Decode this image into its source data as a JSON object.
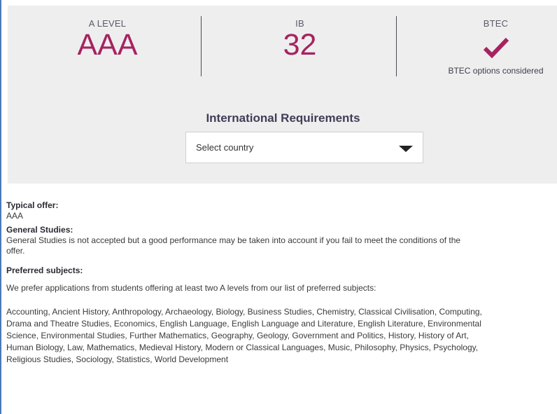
{
  "entry_requirements": {
    "a_level": {
      "label": "A LEVEL",
      "value": "AAA"
    },
    "ib": {
      "label": "IB",
      "value": "32"
    },
    "btec": {
      "label": "BTEC",
      "icon": "checkmark-icon",
      "note": "BTEC options considered"
    }
  },
  "international": {
    "title": "International Requirements",
    "select_placeholder": "Select country"
  },
  "details": {
    "typical_offer_heading": "Typical offer:",
    "typical_offer_value": "AAA",
    "general_studies_heading": "General Studies:",
    "general_studies_text": "General Studies is not accepted but a good performance may be taken into account if you fail to meet the conditions of the offer.",
    "preferred_heading": "Preferred subjects:",
    "preferred_intro": "We prefer applications from students offering at least two A levels from our list of preferred subjects:",
    "preferred_list": "Accounting, Ancient History, Anthropology, Archaeology, Biology, Business Studies, Chemistry, Classical Civilisation, Computing, Drama and Theatre Studies, Economics, English Language, English Language and Literature, English Literature, Environmental Science, Environmental Studies, Further Mathematics, Geography, Geology, Government and Politics, History, History of Art, Human Biology, Law, Mathematics, Medieval History, Modern or Classical Languages, Music, Philosophy, Physics, Psychology, Religious Studies, Sociology, Statistics, World Development"
  },
  "colors": {
    "accent": "#a6235f",
    "panel_bg": "#eeeeef",
    "frame_border": "#4a7ab8"
  }
}
